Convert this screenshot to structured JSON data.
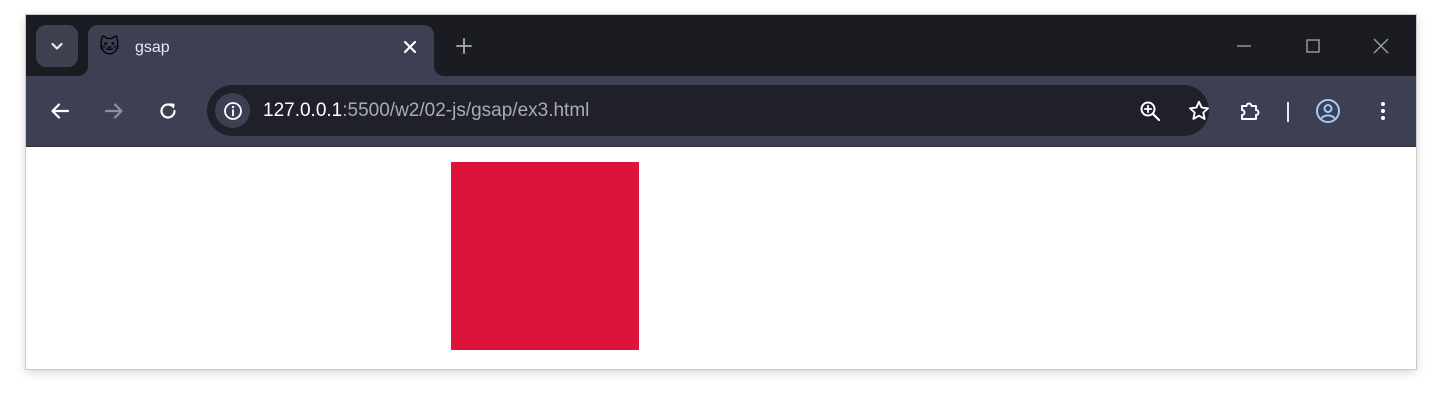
{
  "tab": {
    "favicon": "🐱",
    "title": "gsap"
  },
  "address_bar": {
    "url_host": "127.0.0.1",
    "url_rest": ":5500/w2/02-js/gsap/ex3.html"
  },
  "icons": {
    "tab_search": "chevron-down-icon",
    "tab_close": "close-icon",
    "new_tab": "plus-icon",
    "minimize": "minimize-icon",
    "maximize": "maximize-icon",
    "close_window": "close-icon",
    "back": "arrow-left-icon",
    "forward": "arrow-right-icon",
    "reload": "reload-icon",
    "site_info": "info-icon",
    "zoom": "zoom-in-icon",
    "bookmark": "star-icon",
    "extensions": "puzzle-icon",
    "profile": "account-circle-icon",
    "menu": "more-vertical-icon"
  },
  "page": {
    "box_color": "#dc143c"
  },
  "colors": {
    "tabstrip": "#1b1c21",
    "toolbar": "#3d4053",
    "omnibox": "#1f2029"
  }
}
